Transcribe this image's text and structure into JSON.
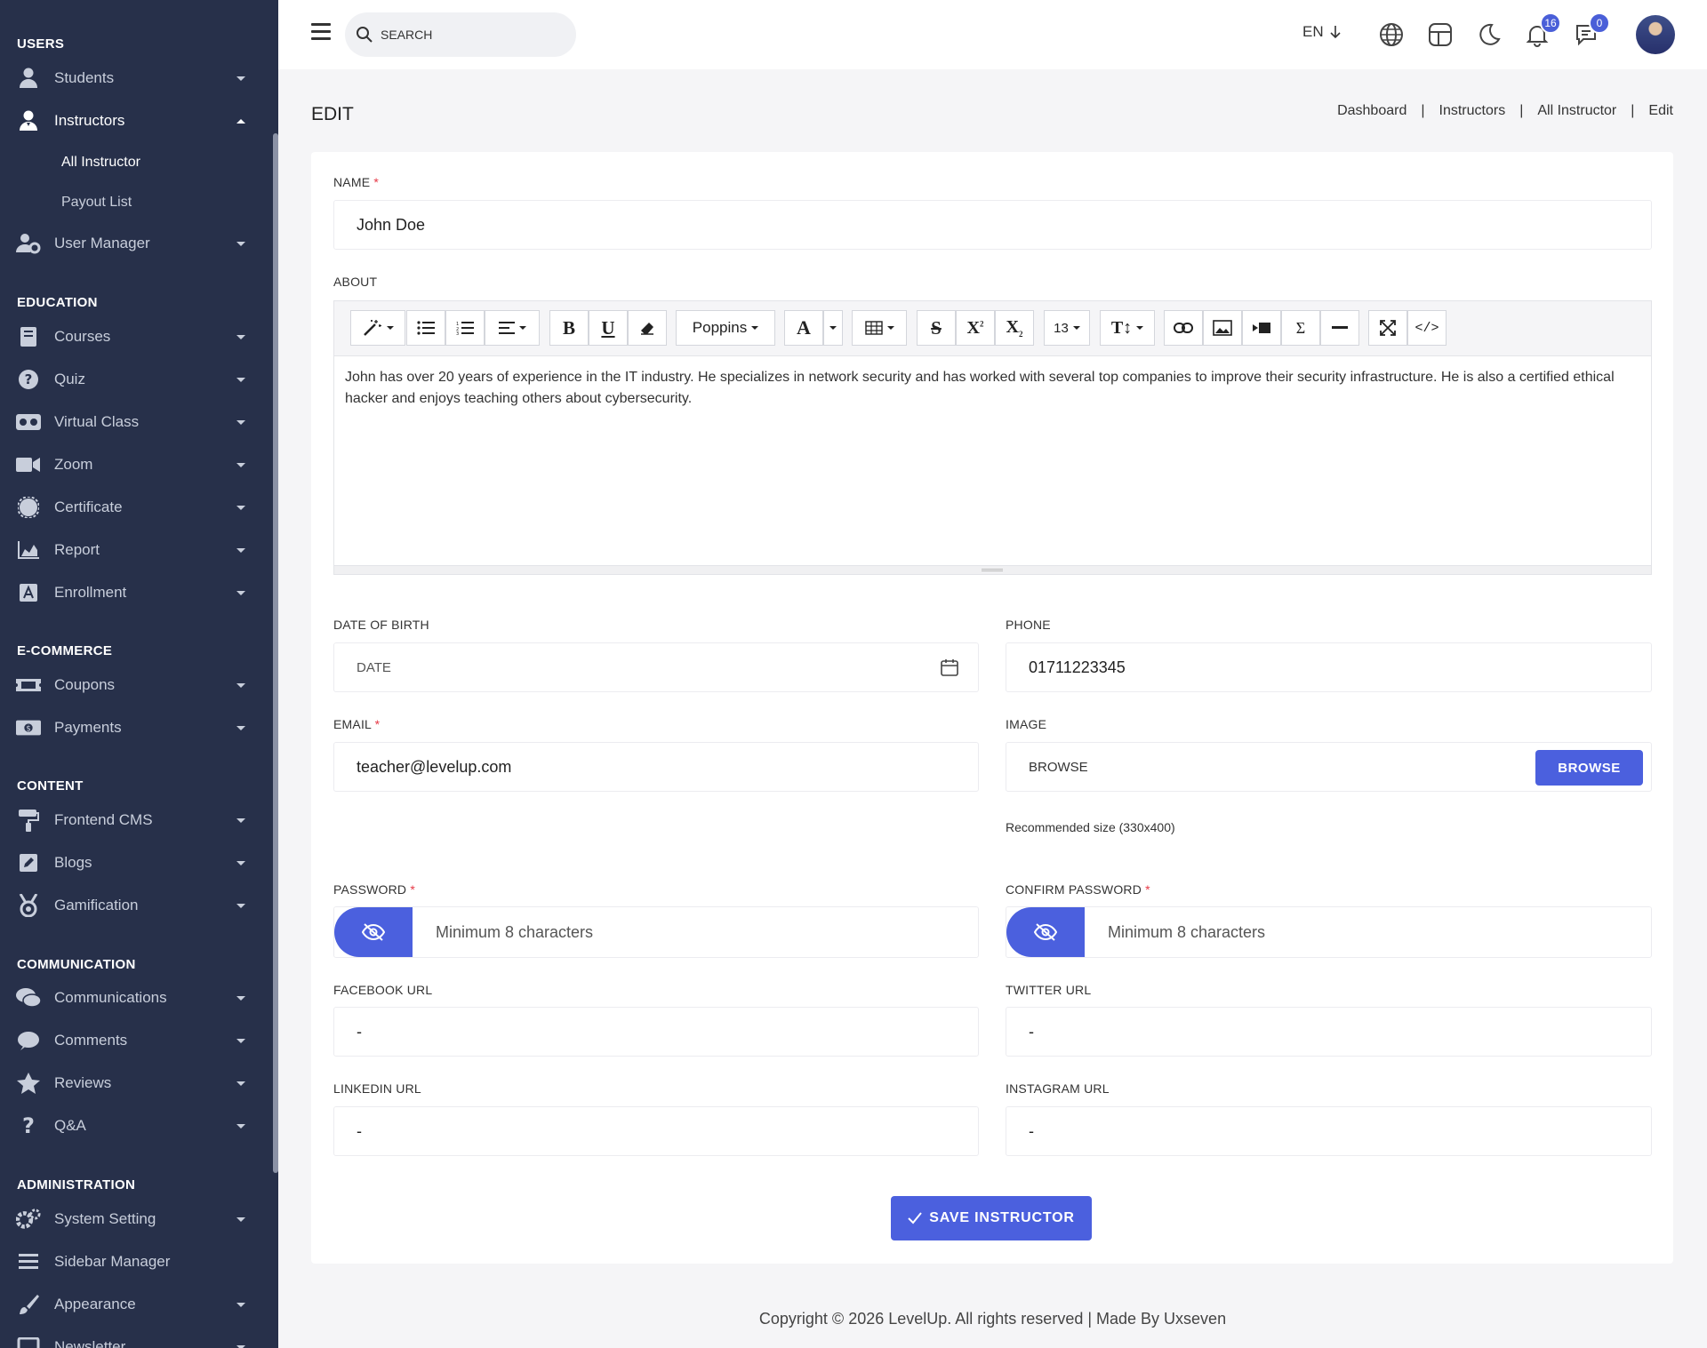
{
  "sidebar": {
    "sections": {
      "users": "USERS",
      "education": "EDUCATION",
      "ecommerce": "E-COMMERCE",
      "content": "CONTENT",
      "communication": "COMMUNICATION",
      "administration": "ADMINISTRATION"
    },
    "items": {
      "students": "Students",
      "instructors": "Instructors",
      "all_instructor": "All Instructor",
      "payout_list": "Payout List",
      "user_manager": "User Manager",
      "courses": "Courses",
      "quiz": "Quiz",
      "virtual_class": "Virtual Class",
      "zoom": "Zoom",
      "certificate": "Certificate",
      "report": "Report",
      "enrollment": "Enrollment",
      "coupons": "Coupons",
      "payments": "Payments",
      "frontend_cms": "Frontend CMS",
      "blogs": "Blogs",
      "gamification": "Gamification",
      "communications": "Communications",
      "comments": "Comments",
      "reviews": "Reviews",
      "qa": "Q&A",
      "system_setting": "System Setting",
      "sidebar_manager": "Sidebar Manager",
      "appearance": "Appearance",
      "newsletter": "Newsletter"
    }
  },
  "topbar": {
    "search_placeholder": "SEARCH",
    "language": "EN",
    "notifications_count": "16",
    "messages_count": "0"
  },
  "page": {
    "title": "EDIT",
    "breadcrumb": [
      "Dashboard",
      "Instructors",
      "All Instructor",
      "Edit"
    ]
  },
  "form": {
    "name_label": "NAME",
    "name_value": "John Doe",
    "about_label": "ABOUT",
    "editor": {
      "font_name": "Poppins",
      "font_size": "13",
      "content": "John has over 20 years of experience in the IT industry. He specializes in network security and has worked with several top companies to improve their security infrastructure. He is also a certified ethical hacker and enjoys teaching others about cybersecurity."
    },
    "dob_label": "DATE OF BIRTH",
    "dob_placeholder": "DATE",
    "phone_label": "PHONE",
    "phone_value": "01711223345",
    "email_label": "EMAIL",
    "email_value": "teacher@levelup.com",
    "image_label": "IMAGE",
    "image_placeholder": "BROWSE",
    "browse_button": "BROWSE",
    "image_hint": "Recommended size (330x400)",
    "password_label": "PASSWORD",
    "password_placeholder": "Minimum 8 characters",
    "confirm_password_label": "CONFIRM PASSWORD",
    "confirm_password_placeholder": "Minimum 8 characters",
    "facebook_label": "FACEBOOK URL",
    "facebook_value": "-",
    "twitter_label": "TWITTER URL",
    "twitter_value": "-",
    "linkedin_label": "LINKEDIN URL",
    "linkedin_value": "-",
    "instagram_label": "INSTAGRAM URL",
    "instagram_value": "-",
    "required_mark": "*",
    "save_button": "SAVE INSTRUCTOR"
  },
  "footer": {
    "text": "Copyright © 2026 LevelUp. All rights reserved | Made By Uxseven"
  },
  "colors": {
    "sidebar_bg": "#27304a",
    "accent": "#4b60de",
    "required": "#e63946"
  }
}
